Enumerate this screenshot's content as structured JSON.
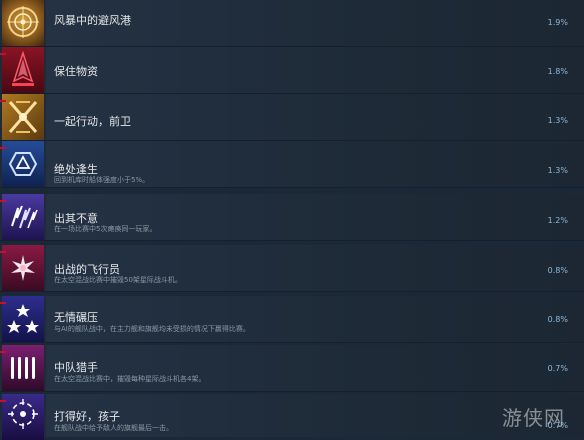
{
  "achievements": [
    {
      "title": "风暴中的避风港",
      "desc": "",
      "percent": "1.9%",
      "icon": "compass-ring-icon",
      "bg": "#8a5a1e"
    },
    {
      "title": "保住物资",
      "desc": "",
      "percent": "1.8%",
      "icon": "red-ship-icon",
      "bg": "#6b0f1e"
    },
    {
      "title": "一起行动，前卫",
      "desc": "",
      "percent": "1.3%",
      "icon": "crossed-swords-icon",
      "bg": "#7a5418"
    },
    {
      "title": "绝处逢生",
      "desc": "回到机库时船体强度小于5%。",
      "percent": "1.3%",
      "icon": "recycle-hexagon-icon",
      "bg": "#1a3a7a"
    },
    {
      "title": "出其不意",
      "desc": "在一场比赛中5次瘫痪同一玩家。",
      "percent": "1.2%",
      "icon": "lightning-shards-icon",
      "bg": "#3a2a7a"
    },
    {
      "title": "出战的飞行员",
      "desc": "在太空混战比赛中摧毁50架星际战斗机。",
      "percent": "0.8%",
      "icon": "explosion-icon",
      "bg": "#7a1a3a"
    },
    {
      "title": "无情碾压",
      "desc": "与AI的舰队战中，在主力舰和旗舰均未受损的情况下赢得比赛。",
      "percent": "0.8%",
      "icon": "three-stars-icon",
      "bg": "#2a2a7a"
    },
    {
      "title": "中队猎手",
      "desc": "在太空混战比赛中，摧毁每种星际战斗机各4架。",
      "percent": "0.7%",
      "icon": "four-bars-icon",
      "bg": "#6a1a5a"
    },
    {
      "title": "打得好，孩子",
      "desc": "在舰队战中给予敌人的旗舰最后一击。",
      "percent": "0.7%",
      "icon": "target-reticle-icon",
      "bg": "#2a1a6a"
    }
  ],
  "watermark": "游侠网"
}
